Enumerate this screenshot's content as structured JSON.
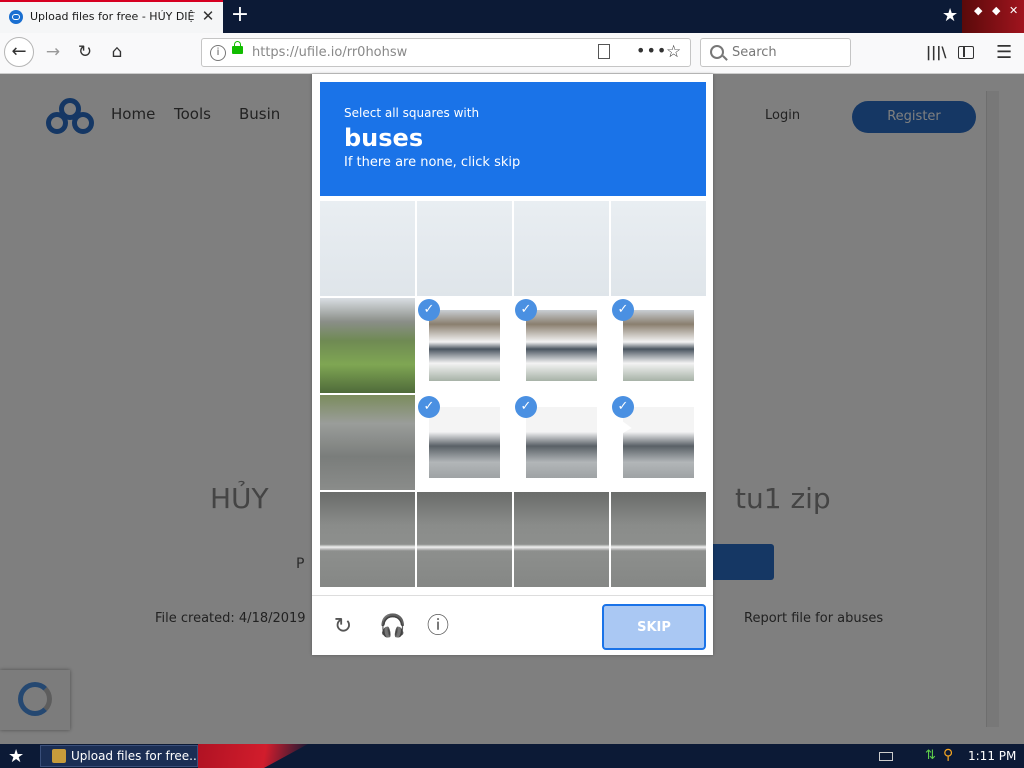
{
  "browser": {
    "tab_title": "Upload files for free - HỦY DIỆT M",
    "tab_close": "✕",
    "new_tab": "+",
    "url": "https://ufile.io/rr0hohsw",
    "search_placeholder": "Search",
    "menu_dots": "•••"
  },
  "page": {
    "nav": [
      "Home",
      "Tools",
      "Busin"
    ],
    "login": "Login",
    "register": "Register",
    "heading_left": "HỦY",
    "heading_right": "tu1 zip",
    "p_letter": "P",
    "file_created": "File created: 4/18/2019",
    "report": "Report file for abuses"
  },
  "captcha": {
    "prompt_small": "Select all squares with",
    "prompt_object": "buses",
    "prompt_sub": "If there are none, click skip",
    "skip_label": "SKIP",
    "check_mark": "✓",
    "selected_tiles": [
      5,
      6,
      7,
      9,
      10,
      11
    ],
    "accent_color": "#1a73e8"
  },
  "taskbar": {
    "task_label": "Upload files for free...",
    "clock": "1:11 PM"
  }
}
